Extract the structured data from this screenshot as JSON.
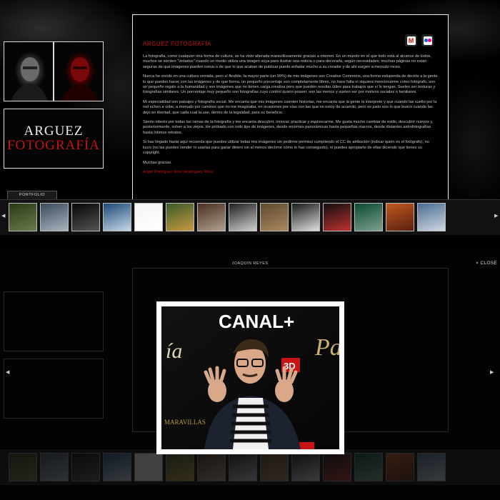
{
  "brand": {
    "line1": "ARGUEZ",
    "line2": "FOTOGRAFÍA",
    "accent": "#c81414"
  },
  "article": {
    "title": "ARGUEZ FOTOGRAFÍA",
    "paragraphs": [
      "La fotografía, como cualquier otra forma de cultura, se ha visto alterada maravillosamente gracias a internet. En un mundo en el que todo está al alcance de todos, muchos se sienten \"violados\" cuando un medio utiliza una imagen suya para ilustrar una noticia o para decorarla, según necesidades; muchas páginas no están seguras de qué imágenes pueden tomar o de que lo que acaban de publicar puede enfadar mucho a su creador y de ahí surgen a menudo roces.",
      "Nunca he creído en una cultura cerrada, pero sí flexible, la mayor parte (un 99%) de mis imágenes son Creative Commons, una forma estupenda de decirle a la gente lo que pueden hacer con las imágenes y de que forma, un pequeño porcentaje son completamente libres, no hace falta ni siquiera mencionarme como fotógrafo, son un pequeño regalo a la humanidad y son imágenes que no tienen carga creativa pero que pueden resultar útiles para trabajos que sí lo tengan. Suelen ser texturas y fotografías similares. Un porcentaje muy pequeño son fotografías cuyo control quiero poseer, son las menos y suelen ser por motivos sociales o familiares.",
      "Mi especialidad son paisajes y fotografía social. Me encanta que mis imágenes cuenten historias, me encanta que la gente la interprete y que cuando las suelto por la red echen a volar, a menudo por caminos que no me imaginaba, en ocasiones por vías con las que no estoy de acuerdo, pero es justo eso lo que busco cuando las dejo en libertad, que cada cual la use, dentro de la legalidad, para su beneficio.",
      "Siento interés por todas las ramas de la fotografía y me encanta descubrir, innovar, practicar y equivocarme. Me gusta mucho cambiar de estilo, descubrir nuevos y, posteriormente, volver a los viejos. He probado con todo tipo de imágenes, desde enormes panorámicas hasta pequeñas macros, desde distantes astrofotografías hasta íntimos retratos.",
      "Si has llegado hasta aquí recuerda que puedes utilizar todas mis imágenes sin pedirme permiso cumpliendo el CC de atribución (indicar quién es el fotógrafo), no lucro (no las puedes vender ni usarlas para ganar dinero sin al menos decírme cómo lo has conseguido), ni puedes apropiarte de ellas diciendo que tienes su copyright.",
      "Muchas gracias."
    ],
    "signature": "Angel Rodríguez Ríos (Rodríguez Ríos)"
  },
  "share": {
    "gmail_icon": "gmail-icon",
    "flickr_icon": "flickr-icon"
  },
  "portfolio": {
    "tab_label": "PORTFOLIO",
    "prev_icon": "arrow-left-icon",
    "next_icon": "arrow-right-icon",
    "thumbs": [
      {
        "name": "thumb-forest",
        "colors": [
          "#2a3a18",
          "#6b7a4a"
        ]
      },
      {
        "name": "thumb-aqueduct",
        "colors": [
          "#3a4a5a",
          "#aab4c0"
        ]
      },
      {
        "name": "thumb-dark-night",
        "colors": [
          "#050505",
          "#555555"
        ]
      },
      {
        "name": "thumb-sea-lighthouse",
        "colors": [
          "#1c4a78",
          "#c8d8e8"
        ]
      },
      {
        "name": "thumb-white",
        "colors": [
          "#f4f4f4",
          "#ffffff"
        ]
      },
      {
        "name": "thumb-hills",
        "colors": [
          "#3a5a2a",
          "#c89a40"
        ]
      },
      {
        "name": "thumb-group-photo",
        "colors": [
          "#4a3020",
          "#b0a090"
        ]
      },
      {
        "name": "thumb-bw-people",
        "colors": [
          "#202020",
          "#d0d0d0"
        ]
      },
      {
        "name": "thumb-dog",
        "colors": [
          "#604a30",
          "#a88860"
        ]
      },
      {
        "name": "thumb-no-sign",
        "colors": [
          "#1a1a1a",
          "#e0e0e0"
        ]
      },
      {
        "name": "thumb-man-event",
        "colors": [
          "#101010",
          "#c03030"
        ]
      },
      {
        "name": "thumb-pool-table",
        "colors": [
          "#0a4a30",
          "#80a090"
        ]
      },
      {
        "name": "thumb-sunset",
        "colors": [
          "#c05820",
          "#5a2010"
        ]
      },
      {
        "name": "thumb-lake",
        "colors": [
          "#4a6a90",
          "#d0dae4"
        ]
      }
    ]
  },
  "lightbox": {
    "caption": "JOAQUIN REYES",
    "close_label": "× CLOSE",
    "prev_icon": "arrow-left-icon",
    "next_icon": "arrow-right-icon",
    "photo_icon": "portrait-photo-icon",
    "banner_text": "CANAL+",
    "badge_text": "3D",
    "title_fragment": "ía",
    "subtitle_fragment": "MARAVILLAS"
  }
}
